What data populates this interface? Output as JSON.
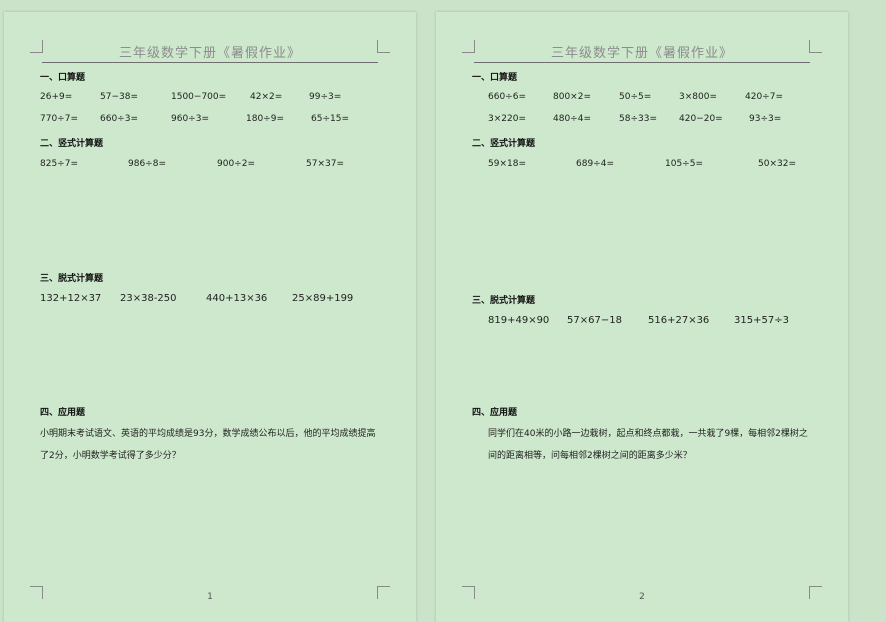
{
  "header_title": "三年级数学下册《暑假作业》",
  "pages": [
    {
      "number": "1",
      "sections": {
        "oral_title": "一、口算题",
        "oral_row1": [
          "26+9=",
          "57−38=",
          "1500−700=",
          "42×2=",
          "99÷3="
        ],
        "oral_row2": [
          "770÷7=",
          "660÷3=",
          "960÷3=",
          "180÷9=",
          "65÷15="
        ],
        "vertical_title": "二、竖式计算题",
        "vertical_row": [
          "825÷7=",
          "986÷8=",
          "900÷2=",
          "57×37="
        ],
        "step_title": "三、脱式计算题",
        "step_row": [
          "132+12×37",
          "23×38-250",
          "440+13×36",
          "25×89+199"
        ],
        "word_title": "四、应用题",
        "word_text": "小明期末考试语文、英语的平均成绩是93分，数学成绩公布以后，他的平均成绩提高了2分，小明数学考试得了多少分？"
      }
    },
    {
      "number": "2",
      "sections": {
        "oral_title": "一、口算题",
        "oral_row1": [
          "660÷6=",
          "800×2=",
          "50÷5=",
          "3×800=",
          "420÷7="
        ],
        "oral_row2": [
          "3×220=",
          "480÷4=",
          "58÷33=",
          "420−20=",
          "93÷3="
        ],
        "vertical_title": "二、竖式计算题",
        "vertical_row": [
          "59×18=",
          "689÷4=",
          "105÷5=",
          "50×32="
        ],
        "step_title": "三、脱式计算题",
        "step_row": [
          "819+49×90",
          "57×67−18",
          "516+27×36",
          "315+57÷3"
        ],
        "word_title": "四、应用题",
        "word_text": "同学们在40米的小路一边栽树，起点和终点都栽，一共栽了9棵，每相邻2棵树之间的距离相等，问每相邻2棵树之间的距离多少米？"
      }
    }
  ]
}
